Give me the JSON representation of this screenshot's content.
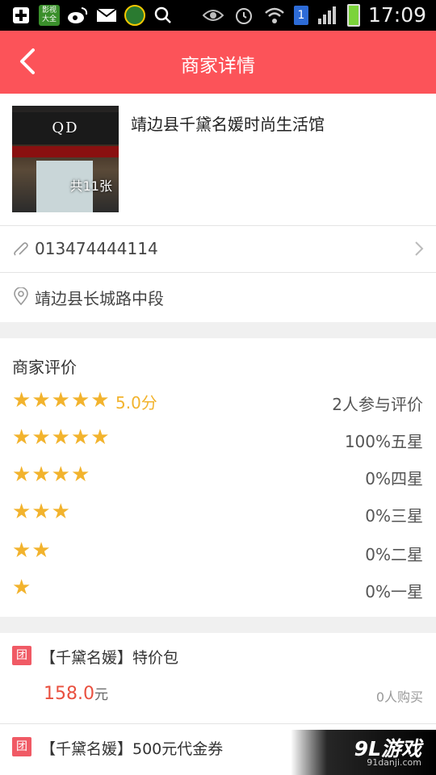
{
  "status_bar": {
    "time": "17:09",
    "sim_number": "1",
    "app_icon_text": "影视大全",
    "icons": [
      "add-icon",
      "video-app-icon",
      "weibo-icon",
      "mail-icon",
      "game-app-icon",
      "search-icon",
      "eye-icon",
      "alarm-icon",
      "wifi-icon",
      "sim-icon",
      "signal-icon",
      "battery-icon"
    ]
  },
  "nav": {
    "title": "商家详情",
    "back_icon": "chevron-left-icon"
  },
  "shop": {
    "name": "靖边县千黛名媛时尚生活馆",
    "photo_sign": "QD",
    "photo_count": "共11张",
    "phone": "013474444114",
    "address": "靖边县长城路中段"
  },
  "ratings": {
    "title": "商家评价",
    "score": "5.0分",
    "participants": "2人参与评价",
    "star_color": "#f2b32d",
    "rows": [
      {
        "stars": 5,
        "label": "100%五星"
      },
      {
        "stars": 4,
        "label": "0%四星"
      },
      {
        "stars": 3,
        "label": "0%三星"
      },
      {
        "stars": 2,
        "label": "0%二星"
      },
      {
        "stars": 1,
        "label": "0%一星"
      }
    ]
  },
  "deals": [
    {
      "badge": "团",
      "title": "【千黛名媛】特价包",
      "price": "158.0",
      "unit": "元",
      "sold": "0人购买"
    },
    {
      "badge": "团",
      "title": "【千黛名媛】500元代金券"
    }
  ],
  "watermark": {
    "logo": "9L游戏",
    "site": "91danji.com"
  },
  "colors": {
    "accent": "#fc5359",
    "price": "#e9503f",
    "badge": "#f05a65"
  }
}
